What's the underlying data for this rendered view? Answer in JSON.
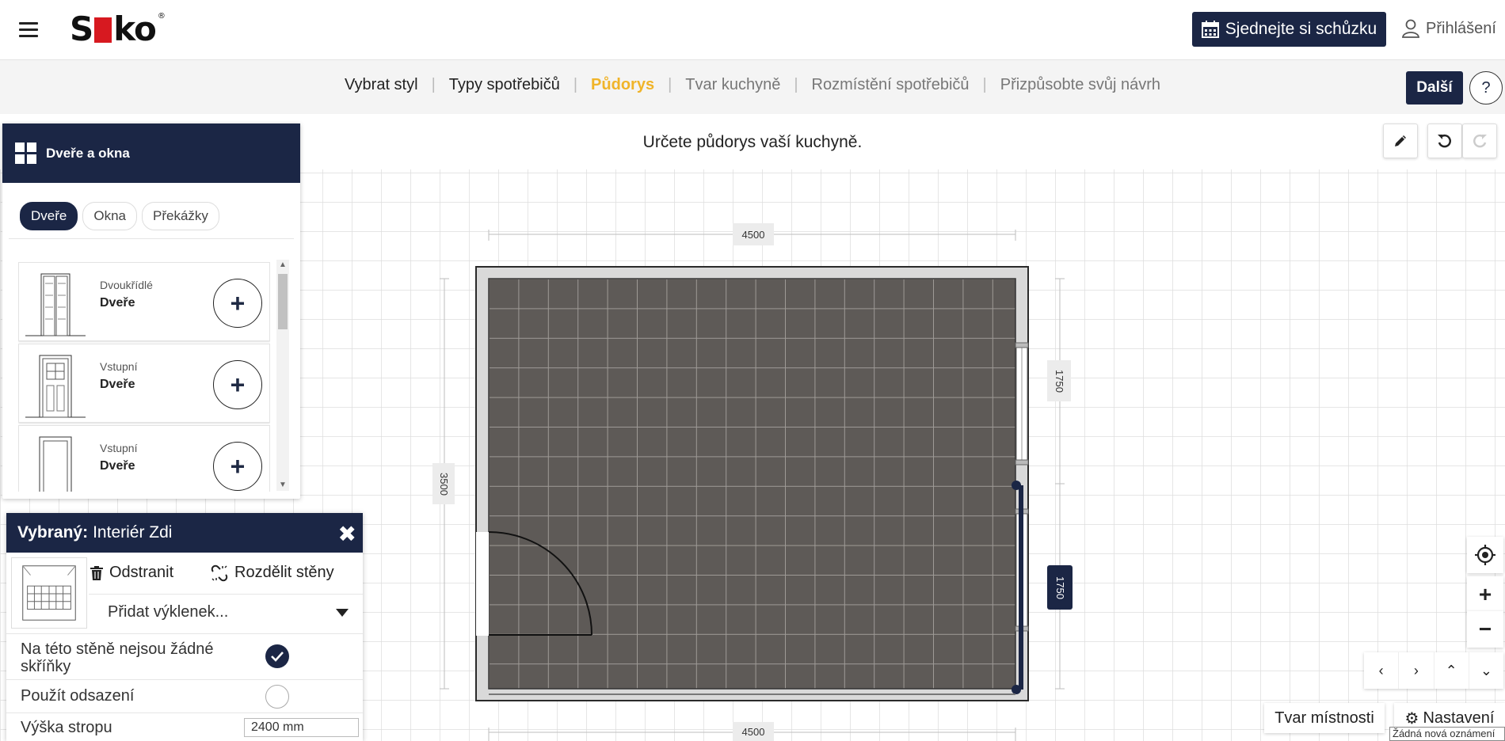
{
  "header": {
    "logo_text": "Siko",
    "logo_mark": "®",
    "meeting_button": "Sjednejte si schůzku",
    "login_label": "Přihlášení"
  },
  "steps": [
    {
      "label": "Vybrat styl",
      "state": "done"
    },
    {
      "label": "Typy spotřebičů",
      "state": "done"
    },
    {
      "label": "Půdorys",
      "state": "active"
    },
    {
      "label": "Tvar kuchyně",
      "state": "todo"
    },
    {
      "label": "Rozmístění spotřebičů",
      "state": "todo"
    },
    {
      "label": "Přizpůsobte svůj návrh",
      "state": "todo"
    }
  ],
  "step_separator": "|",
  "next_button": "Další",
  "help_button": "?",
  "instruction": "Určete půdorys vaší kuchyně.",
  "door_panel": {
    "title": "Dveře a okna",
    "tabs": [
      "Dveře",
      "Okna",
      "Překážky"
    ],
    "active_tab": "Dveře",
    "items": [
      {
        "type": "Dvoukřídlé",
        "name": "Dveře"
      },
      {
        "type": "Vstupní",
        "name": "Dveře"
      },
      {
        "type": "Vstupní",
        "name": "Dveře"
      }
    ]
  },
  "selected_panel": {
    "title_prefix": "Vybraný:",
    "title_value": "Interiér Zdi",
    "delete_label": "Odstranit",
    "split_label": "Rozdělit stěny",
    "alcove_placeholder": "Přidat výklenek...",
    "no_cabinets_label": "Na této stěně nejsou žádné skříňky",
    "no_cabinets_checked": true,
    "offset_label": "Použít odsazení",
    "offset_checked": false,
    "ceiling_label": "Výška stropu",
    "ceiling_value": "2400 mm"
  },
  "floorplan": {
    "dim_top": "4500",
    "dim_bottom": "4500",
    "dim_left": "3500",
    "dim_right_upper": "1750",
    "dim_right_lower": "1750"
  },
  "controls": {
    "zoom_in": "+",
    "zoom_out": "−",
    "room_shape_button": "Tvar místnosti",
    "settings_button": "Nastavení",
    "notice": "Žádná nová oznámení"
  },
  "colors": {
    "navy": "#1b2645",
    "active_step": "#f0b429",
    "floor": "#5e5a57"
  }
}
